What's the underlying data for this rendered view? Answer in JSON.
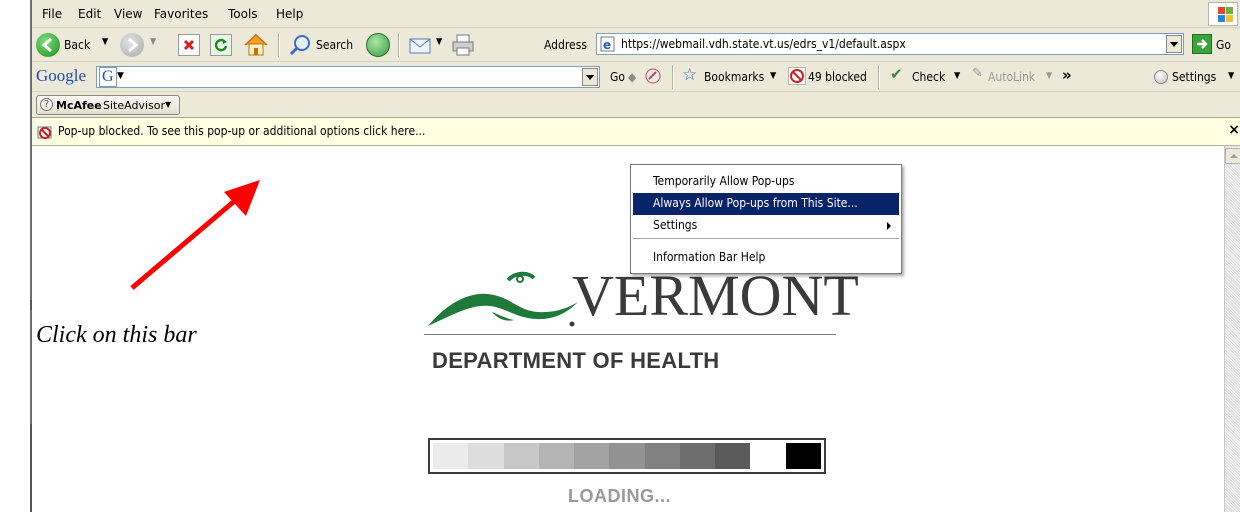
{
  "menu": [
    "File",
    "Edit",
    "View",
    "Favorites",
    "Tools",
    "Help"
  ],
  "nav": {
    "back_label": "Back",
    "search_label": "Search",
    "address_label": "Address",
    "url": "https://webmail.vdh.state.vt.us/edrs_v1/default.aspx",
    "go_label": "Go"
  },
  "google_bar": {
    "logo": "Google",
    "g_label": "G",
    "go_label": "Go",
    "bookmarks_label": "Bookmarks",
    "blocked_label": "49 blocked",
    "check_label": "Check",
    "autolink_label": "AutoLink",
    "more_label": "»",
    "settings_label": "Settings"
  },
  "mcafee": {
    "brand": "McAfee",
    "product": "SiteAdvisor"
  },
  "infobar": {
    "text": "Pop-up blocked. To see this pop-up or additional options click here...",
    "close": "×"
  },
  "context_menu": {
    "items": [
      "Temporarily Allow Pop-ups",
      "Always Allow Pop-ups from This Site...",
      "Settings",
      "Information Bar Help"
    ],
    "selected_index": 1
  },
  "annotation": "Click on this bar",
  "logo": {
    "word": "VERMONT",
    "department": "DEPARTMENT OF HEALTH"
  },
  "loading_text": "LOADING...",
  "colors": {
    "arrow": "#ff0000",
    "menu_highlight": "#0a246a",
    "infobar_bg": "#ffffe1",
    "vermont_green": "#1f7a3a",
    "chrome_bg": "#ece9d8"
  }
}
